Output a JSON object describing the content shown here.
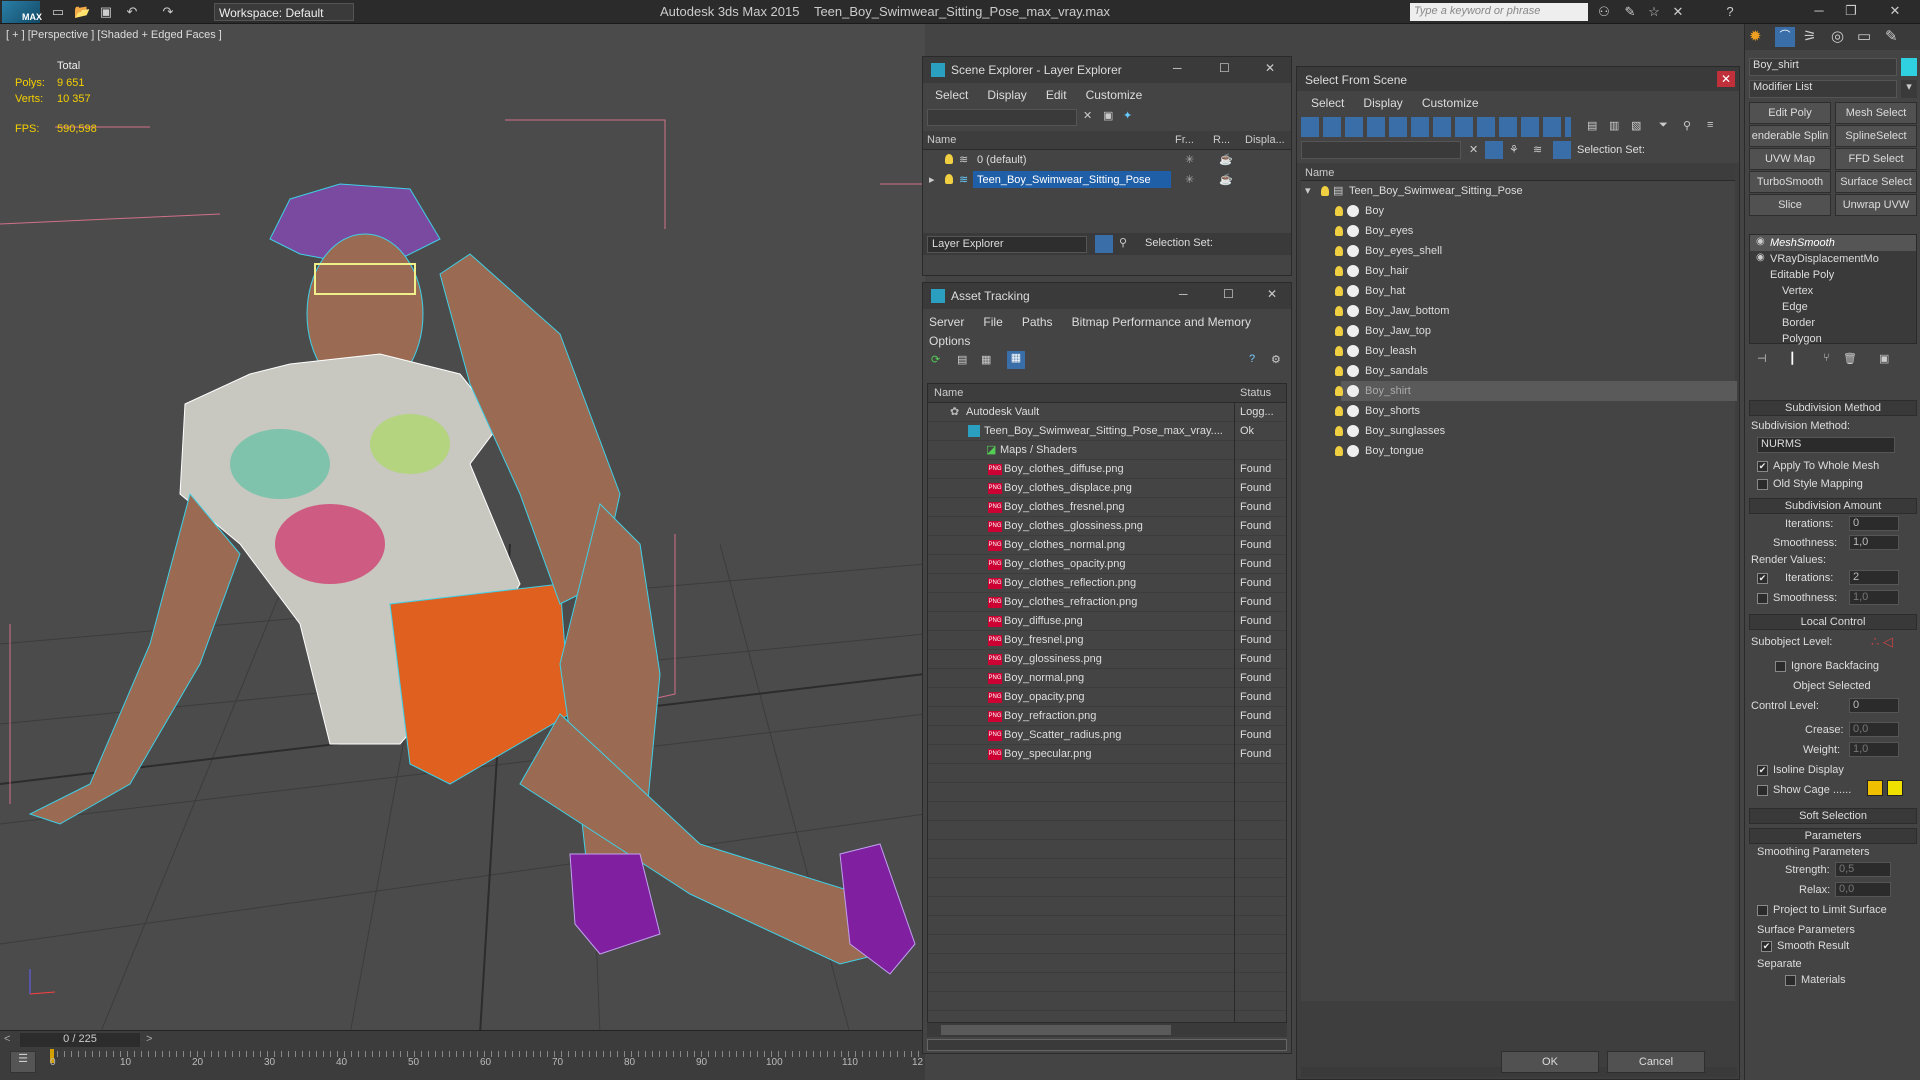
{
  "app": {
    "title": "Autodesk 3ds Max  2015",
    "file": "Teen_Boy_Swimwear_Sitting_Pose_max_vray.max",
    "logo": "MAX",
    "workspace": "Workspace: Default",
    "search_placeholder": "Type a keyword or phrase"
  },
  "viewport": {
    "label": "[ + ] [Perspective ] [Shaded + Edged Faces ]",
    "total": "Total",
    "polys_label": "Polys:",
    "polys": "9 651",
    "verts_label": "Verts:",
    "verts": "10 357",
    "fps_label": "FPS:",
    "fps": "590,598"
  },
  "timeline": {
    "frame": "0 / 225",
    "ticks": [
      "0",
      "10",
      "20",
      "30",
      "40",
      "50",
      "60",
      "70",
      "80",
      "90",
      "100",
      "110",
      "12"
    ]
  },
  "scene_explorer": {
    "title": "Scene Explorer - Layer Explorer",
    "menu": [
      "Select",
      "Display",
      "Edit",
      "Customize"
    ],
    "columns": [
      "Name",
      "Fr...",
      "R...",
      "Displa..."
    ],
    "layers": [
      "0 (default)",
      "Teen_Boy_Swimwear_Sitting_Pose"
    ],
    "footer_dropdown": "Layer Explorer",
    "selection_set": "Selection Set:"
  },
  "asset_tracking": {
    "title": "Asset Tracking",
    "menu": [
      "Server",
      "File",
      "Paths",
      "Bitmap Performance and Memory"
    ],
    "menu2": "Options",
    "columns": [
      "Name",
      "Status"
    ],
    "vault": "Autodesk Vault",
    "vault_status": "Logg...",
    "file": "Teen_Boy_Swimwear_Sitting_Pose_max_vray....",
    "file_status": "Ok",
    "maps_folder": "Maps / Shaders",
    "maps": [
      "Boy_clothes_diffuse.png",
      "Boy_clothes_displace.png",
      "Boy_clothes_fresnel.png",
      "Boy_clothes_glossiness.png",
      "Boy_clothes_normal.png",
      "Boy_clothes_opacity.png",
      "Boy_clothes_reflection.png",
      "Boy_clothes_refraction.png",
      "Boy_diffuse.png",
      "Boy_fresnel.png",
      "Boy_glossiness.png",
      "Boy_normal.png",
      "Boy_opacity.png",
      "Boy_refraction.png",
      "Boy_Scatter_radius.png",
      "Boy_specular.png"
    ],
    "map_status": "Found"
  },
  "select_from_scene": {
    "title": "Select From Scene",
    "menu": [
      "Select",
      "Display",
      "Customize"
    ],
    "selection_set": "Selection Set:",
    "column": "Name",
    "root": "Teen_Boy_Swimwear_Sitting_Pose",
    "objects": [
      "Boy",
      "Boy_eyes",
      "Boy_eyes_shell",
      "Boy_hair",
      "Boy_hat",
      "Boy_Jaw_bottom",
      "Boy_Jaw_top",
      "Boy_leash",
      "Boy_sandals",
      "Boy_shirt",
      "Boy_shorts",
      "Boy_sunglasses",
      "Boy_tongue"
    ],
    "selected": "Boy_shirt",
    "ok": "OK",
    "cancel": "Cancel"
  },
  "command_panel": {
    "object_name": "Boy_shirt",
    "modifier_list": "Modifier List",
    "buttons": [
      "Edit Poly",
      "Mesh Select",
      "enderable Splin",
      "SplineSelect",
      "UVW Map",
      "FFD Select",
      "TurboSmooth",
      "Surface Select",
      "Slice",
      "Unwrap UVW"
    ],
    "stack": [
      "MeshSmooth",
      "VRayDisplacementMo",
      "Editable Poly",
      "Vertex",
      "Edge",
      "Border",
      "Polygon"
    ],
    "subdivision_method_title": "Subdivision Method",
    "subdivision_method_label": "Subdivision Method:",
    "subdivision_method": "NURMS",
    "apply_whole_mesh": "Apply To Whole Mesh",
    "old_style_mapping": "Old Style Mapping",
    "subdivision_amount_title": "Subdivision Amount",
    "iterations_label": "Iterations:",
    "iterations": "0",
    "smoothness_label": "Smoothness:",
    "smoothness": "1,0",
    "render_values": "Render Values:",
    "render_iterations": "2",
    "render_smoothness": "1,0",
    "local_control_title": "Local Control",
    "subobject_level": "Subobject Level:",
    "ignore_backfacing": "Ignore Backfacing",
    "object_selected": "Object Selected",
    "control_level_label": "Control Level:",
    "control_level": "0",
    "crease_label": "Crease:",
    "crease": "0,0",
    "weight_label": "Weight:",
    "weight": "1,0",
    "isoline_display": "Isoline Display",
    "show_cage": "Show Cage ......",
    "soft_selection": "Soft Selection",
    "parameters": "Parameters",
    "smoothing_parameters": "Smoothing Parameters",
    "strength_label": "Strength:",
    "strength": "0,5",
    "relax_label": "Relax:",
    "relax": "0,0",
    "project_limit": "Project to Limit Surface",
    "surface_parameters": "Surface Parameters",
    "smooth_result": "Smooth Result",
    "separate": "Separate",
    "materials": "Materials"
  }
}
